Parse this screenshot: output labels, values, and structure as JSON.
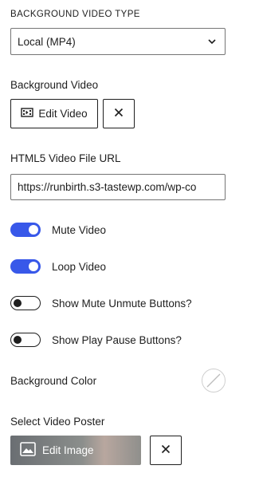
{
  "section": {
    "title": "BACKGROUND VIDEO TYPE"
  },
  "video_type": {
    "selected": "Local (MP4)"
  },
  "background_video": {
    "label": "Background Video",
    "edit_label": "Edit Video"
  },
  "file_url": {
    "label": "HTML5 Video File URL",
    "value": "https://runbirth.s3-tastewp.com/wp-co"
  },
  "toggles": [
    {
      "label": "Mute Video",
      "on": true
    },
    {
      "label": "Loop Video",
      "on": true
    },
    {
      "label": "Show Mute Unmute Buttons?",
      "on": false
    },
    {
      "label": "Show Play Pause Buttons?",
      "on": false
    }
  ],
  "background_color": {
    "label": "Background Color"
  },
  "poster": {
    "label": "Select Video Poster",
    "edit_label": "Edit Image"
  },
  "colors": {
    "accent": "#3858e9",
    "text": "#1e1e1e",
    "border": "#757575"
  }
}
